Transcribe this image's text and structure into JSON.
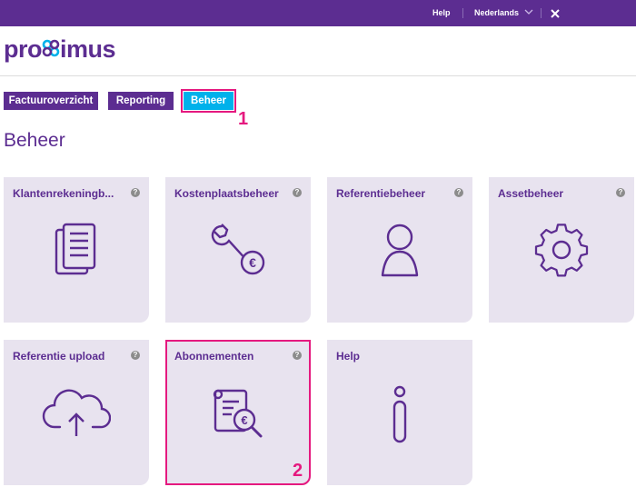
{
  "topbar": {
    "help": "Help",
    "language": "Nederlands"
  },
  "brand": {
    "logo_pre": "pro",
    "logo_post": "imus"
  },
  "tabs": [
    {
      "label": "Factuuroverzicht",
      "active": false
    },
    {
      "label": "Reporting",
      "active": false
    },
    {
      "label": "Beheer",
      "active": true
    }
  ],
  "markers": {
    "one": "1",
    "two": "2"
  },
  "page": {
    "title": "Beheer"
  },
  "tiles": [
    {
      "label": "Klantenrekeningb...",
      "icon": "documents-icon",
      "help": "?"
    },
    {
      "label": "Kostenplaatsbeheer",
      "icon": "wrench-euro-icon",
      "help": "?"
    },
    {
      "label": "Referentiebeheer",
      "icon": "person-icon",
      "help": "?"
    },
    {
      "label": "Assetbeheer",
      "icon": "gear-icon",
      "help": "?"
    },
    {
      "label": "Referentie upload",
      "icon": "cloud-upload-icon",
      "help": "?"
    },
    {
      "label": "Abonnementen",
      "icon": "invoice-search-icon",
      "help": "?"
    },
    {
      "label": "Help",
      "icon": "info-icon",
      "help": ""
    }
  ],
  "colors": {
    "brand": "#5c2d91",
    "active_tab": "#00b1eb",
    "highlight": "#e5197f",
    "tile_bg": "#e8e3ef"
  }
}
